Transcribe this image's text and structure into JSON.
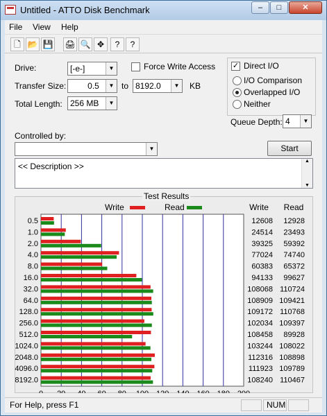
{
  "window": {
    "title": "Untitled - ATTO Disk Benchmark"
  },
  "title_buttons": {
    "minimize": "–",
    "maximize": "□",
    "close": "✕"
  },
  "menu": [
    "File",
    "View",
    "Help"
  ],
  "toolbar_icons": [
    "new-icon",
    "open-icon",
    "save-icon",
    "print-icon",
    "print-preview-icon",
    "move-icon",
    "help-icon",
    "context-help-icon"
  ],
  "toolbar_glyphs": [
    "🗋",
    "📂",
    "💾",
    "🖨",
    "🔍",
    "✥",
    "?",
    "?"
  ],
  "form": {
    "drive_label": "Drive:",
    "drive_value": "[-e-]",
    "force_write_label": "Force Write Access",
    "direct_io_label": "Direct I/O",
    "direct_io_checked": true,
    "transfer_size_label": "Transfer Size:",
    "transfer_from": "0.5",
    "to_label": "to",
    "transfer_to": "8192.0",
    "kb_label": "KB",
    "total_length_label": "Total Length:",
    "total_length": "256 MB",
    "io_comparison_label": "I/O Comparison",
    "overlapped_io_label": "Overlapped I/O",
    "neither_label": "Neither",
    "selected_mode": "Overlapped I/O",
    "queue_depth_label": "Queue Depth:",
    "queue_depth": "4",
    "controlled_by_label": "Controlled by:",
    "controlled_by_value": "",
    "start_label": "Start",
    "description": "<< Description >>"
  },
  "results": {
    "group_label": "Test Results",
    "col_write": "Write",
    "col_read": "Read",
    "rows": [
      {
        "size": "0.5",
        "write": "12608",
        "read": "12928"
      },
      {
        "size": "1.0",
        "write": "24514",
        "read": "23493"
      },
      {
        "size": "2.0",
        "write": "39325",
        "read": "59392"
      },
      {
        "size": "4.0",
        "write": "77024",
        "read": "74740"
      },
      {
        "size": "8.0",
        "write": "60383",
        "read": "65372"
      },
      {
        "size": "16.0",
        "write": "94133",
        "read": "99627"
      },
      {
        "size": "32.0",
        "write": "108068",
        "read": "110724"
      },
      {
        "size": "64.0",
        "write": "108909",
        "read": "109421"
      },
      {
        "size": "128.0",
        "write": "109172",
        "read": "110768"
      },
      {
        "size": "256.0",
        "write": "102034",
        "read": "109397"
      },
      {
        "size": "512.0",
        "write": "108458",
        "read": "89928"
      },
      {
        "size": "1024.0",
        "write": "103244",
        "read": "108022"
      },
      {
        "size": "2048.0",
        "write": "112316",
        "read": "108898"
      },
      {
        "size": "4096.0",
        "write": "111923",
        "read": "109789"
      },
      {
        "size": "8192.0",
        "write": "108240",
        "read": "110467"
      }
    ]
  },
  "chart_data": {
    "type": "bar",
    "orientation": "horizontal",
    "categories": [
      "0.5",
      "1.0",
      "2.0",
      "4.0",
      "8.0",
      "16.0",
      "32.0",
      "64.0",
      "128.0",
      "256.0",
      "512.0",
      "1024.0",
      "2048.0",
      "4096.0",
      "8192.0"
    ],
    "series": [
      {
        "name": "Write",
        "color": "#e02020",
        "values": [
          12.6,
          24.5,
          39.3,
          77.0,
          60.4,
          94.1,
          108.1,
          108.9,
          109.2,
          102.0,
          108.5,
          103.2,
          112.3,
          111.9,
          108.2
        ]
      },
      {
        "name": "Read",
        "color": "#1a8a1a",
        "values": [
          12.9,
          23.5,
          59.4,
          74.7,
          65.4,
          99.6,
          110.7,
          109.4,
          110.8,
          109.4,
          89.9,
          108.0,
          108.9,
          109.8,
          110.5
        ]
      }
    ],
    "xlabel": "Transfer Rate - MB / Sec",
    "xticks": [
      "0",
      "20",
      "40",
      "60",
      "80",
      "100",
      "120",
      "140",
      "160",
      "180",
      "200"
    ],
    "xlim": [
      0,
      200
    ],
    "grid": true,
    "legend": "top"
  },
  "status": {
    "help_text": "For Help, press F1",
    "num": "NUM"
  },
  "colors": {
    "grid_line": "#3030a0",
    "write": "#e02020",
    "read": "#1a8a1a"
  }
}
